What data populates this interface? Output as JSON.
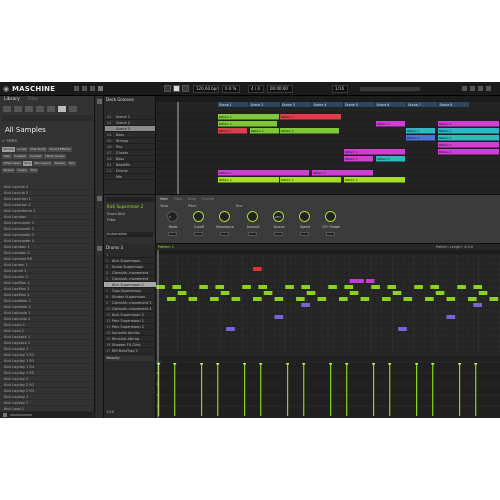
{
  "app": {
    "name": "MASCHINE"
  },
  "topbar": {
    "tempo": "120.00 bpm",
    "swing": "0.0 %",
    "signature": "4 / 4",
    "position": "00:00:00",
    "grid": "1/16"
  },
  "browser": {
    "tabs": [
      "Library",
      "Files"
    ],
    "title": "All Samples",
    "types_label": "> TYPES",
    "type_chips_row1": [
      "Drums",
      "Loops",
      "One Shots",
      "Sound Effects"
    ],
    "type_chips_row2": [
      "Clap",
      "Cowbell",
      "Cymbal",
      "Hihat Closed"
    ],
    "type_chips_row3": [
      "Hihat Open",
      "Kick",
      "Percussion",
      "Shaker",
      "Rim",
      "Snare",
      "Tom"
    ],
    "type_chips_row4": [
      "Shaker",
      "Snare",
      "Tom"
    ],
    "list": [
      "Kick Lavinia 4",
      "Kick Lavinia 5",
      "Kick Laserton 1",
      "Kick Laserton 2",
      "Kick Laventaure 1",
      "Kick Lamban",
      "Kick Lamcaster 1",
      "Kick Lamcaster 2",
      "Kick Lamcaster 3",
      "Kick Lamcaster 4",
      "Kick Lamban 1",
      "Kick Lamban 2",
      "Kick Lamson RR",
      "Kick Lauren 1",
      "Kick Laurel 2",
      "Kick Lauren 3",
      "Kick LaeMan 1",
      "Kick LaeMan 2",
      "Kick LaeMan 3",
      "Kick Laeteker 1",
      "Kick Laeteker 2",
      "Kick Lakcode 1",
      "Kick Lakcode 2",
      "Kick Lavin 1",
      "Kick Lavo 2",
      "Kick Layback 1",
      "Kick Layback 2",
      "Kick Layday 1",
      "Kick Layday 1 R2",
      "Kick Layday 1 R3",
      "Kick Layday 1 R4",
      "Kick Layday 1 R5",
      "Kick Layday 2",
      "Kick Layday 2 R2",
      "Kick Layday 2 R3",
      "Kick Layboy 1",
      "Kick Layboy 2",
      "Kick Lead 1",
      "Kick Lead 2",
      "Kick LeBoss 1",
      "Kick LeBoss 2",
      "Kick LeBoss 3",
      "Kick Legion 1",
      "Kick Legion 2",
      "Kick Legion 3"
    ]
  },
  "arranger": {
    "group_header": "Deck Grooves",
    "groups": [
      {
        "id": "A1",
        "name": "Scene 1"
      },
      {
        "id": "A2",
        "name": "Scene 2"
      },
      {
        "id": "A3",
        "name": "Scene 3"
      },
      {
        "id": "A4",
        "name": "Bass"
      },
      {
        "id": "A5",
        "name": "Strings"
      },
      {
        "id": "A6",
        "name": "Pno"
      },
      {
        "id": "A7",
        "name": "Chords"
      },
      {
        "id": "A8",
        "name": "Bass"
      },
      {
        "id": "B1",
        "name": "BassMix"
      },
      {
        "id": "C1",
        "name": "Drums"
      },
      {
        "id": "",
        "name": "Mix"
      }
    ],
    "scenes": [
      "Scene 1",
      "Scene 2",
      "Scene 3",
      "Scene 4",
      "Scene 5",
      "Scene 6",
      "Scene 7",
      "Scene 8"
    ],
    "clip_label": "Pattern 1"
  },
  "control": {
    "sound_name": "Kick Supermoon 2",
    "tabs": [
      "Main",
      "Drum Kick",
      "Pitch",
      "Amp",
      "Engine",
      "Filter"
    ],
    "module": "Automation",
    "sections": [
      "Tone",
      "Pitch",
      "Env"
    ],
    "knobs": [
      "Mode",
      "Cutoff",
      "Resonance",
      "Amount",
      "Source",
      "Speed",
      "LFO Shape"
    ],
    "knob_values": [
      "1",
      "",
      "",
      "",
      "LFO",
      "",
      ""
    ]
  },
  "pattern": {
    "group_name": "Drums 3",
    "pattern_label": "Pattern 1",
    "pattern_length": "Pattern Length: 4:0:0",
    "sounds": [
      {
        "id": "1",
        "name": ""
      },
      {
        "id": "2",
        "name": "Kick Supermoon"
      },
      {
        "id": "3",
        "name": "Snare Supermoon"
      },
      {
        "id": "4",
        "name": "Clamshk..movement"
      },
      {
        "id": "5",
        "name": "Clamshk..movement"
      },
      {
        "id": "6",
        "name": "Kick Supermoon 2"
      },
      {
        "id": "7",
        "name": "Clap Supermoon"
      },
      {
        "id": "8",
        "name": "Shaker Supermoon"
      },
      {
        "id": "9",
        "name": "Clamshk..movement 3"
      },
      {
        "id": "10",
        "name": "Clamshk..movement 4"
      },
      {
        "id": "11",
        "name": "Kick Supermoon 3"
      },
      {
        "id": "12",
        "name": "Perc Supermoon 1"
      },
      {
        "id": "13",
        "name": "Perc Supermoon 2"
      },
      {
        "id": "14",
        "name": "Sonorito Annika"
      },
      {
        "id": "15",
        "name": "Rimshot Athraa"
      },
      {
        "id": "16",
        "name": "Shooter FX Glint"
      },
      {
        "id": "17",
        "name": "Riff BeatTrap 5"
      }
    ],
    "velocity_label": "Velocity",
    "velocity_values": [
      "100",
      "80",
      "60",
      "40",
      "20"
    ]
  },
  "status": {
    "page": "1/16"
  },
  "colors": {
    "clip_green": "#7fc83a",
    "clip_lime": "#a6dd2a",
    "clip_red": "#d8414b",
    "clip_magenta": "#d03fd4",
    "clip_teal": "#2fb8c2",
    "clip_blue": "#4f74d8",
    "note_green": "#8bd21e",
    "note_purple": "#7a62d8",
    "note_magenta": "#c63bd4",
    "note_red": "#e2333a"
  }
}
